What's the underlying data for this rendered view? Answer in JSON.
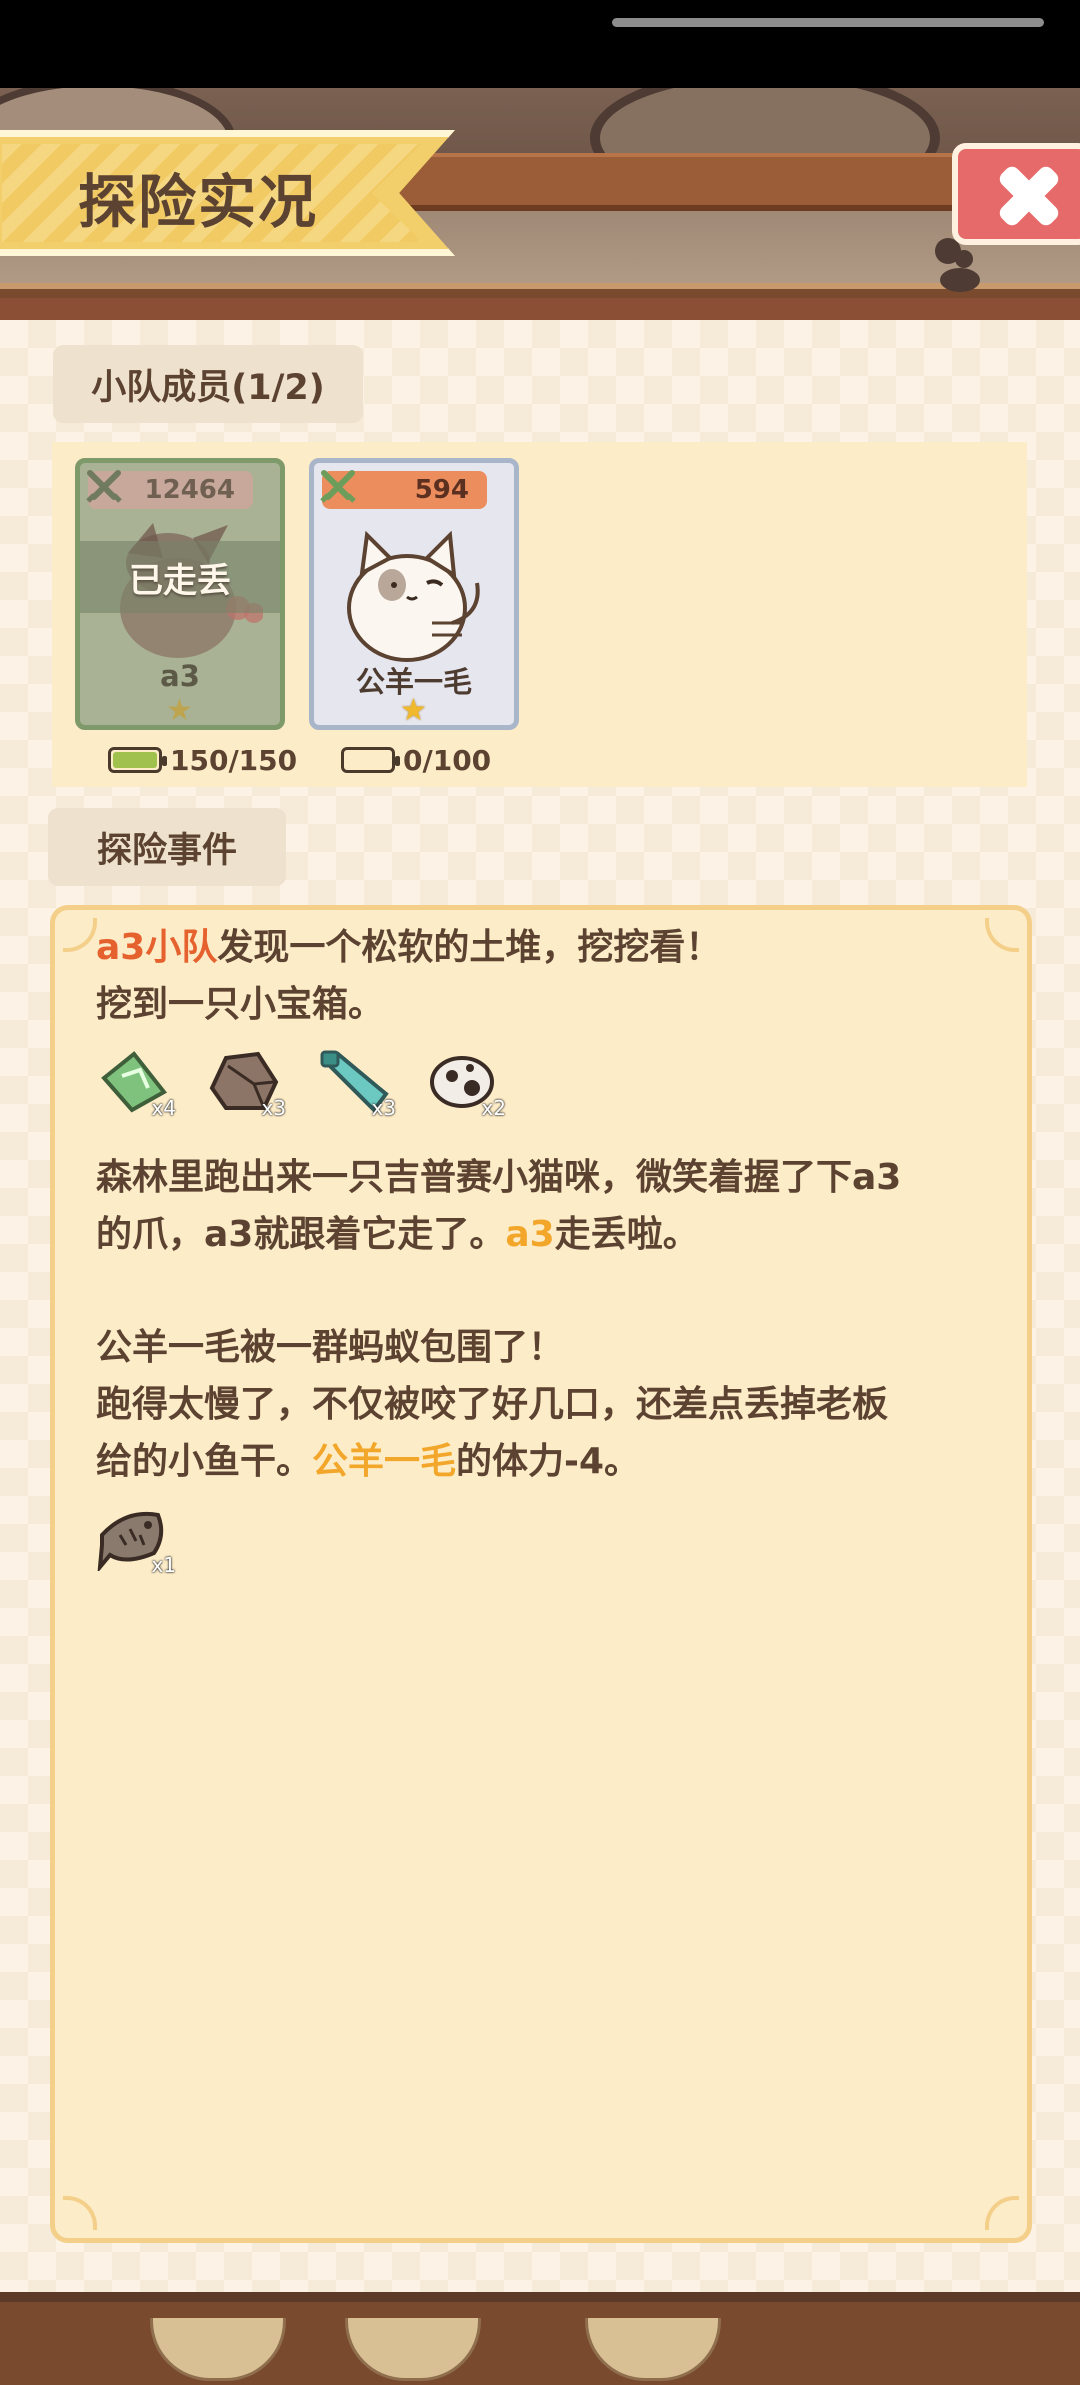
{
  "header": {
    "title": "探险实况",
    "close_icon": "close-x-icon"
  },
  "team": {
    "label": "小队成员(1/2)",
    "members": [
      {
        "name": "a3",
        "power": "12464",
        "status": "已走丢",
        "stamina": "150/150",
        "stamina_fraction": 1.0,
        "stars": 1
      },
      {
        "name": "公羊一毛",
        "power": "594",
        "status": "",
        "stamina": "0/100",
        "stamina_fraction": 0.0,
        "stars": 1
      }
    ]
  },
  "events": {
    "label": "探险事件",
    "paragraphs": [
      {
        "lines": [
          {
            "parts": [
              {
                "text": "a3小队",
                "style": "red"
              },
              {
                "text": "发现一个松软的土堆，挖挖看！",
                "style": "normal"
              }
            ]
          },
          {
            "parts": [
              {
                "text": "挖到一只小宝箱。",
                "style": "normal"
              }
            ]
          }
        ],
        "items": [
          {
            "icon": "green-crystal-icon",
            "qty": "x4"
          },
          {
            "icon": "rock-icon",
            "qty": "x3"
          },
          {
            "icon": "bottle-icon",
            "qty": "x3"
          },
          {
            "icon": "spotted-egg-icon",
            "qty": "x2"
          }
        ]
      },
      {
        "lines": [
          {
            "parts": [
              {
                "text": "森林里跑出来一只吉普赛小猫咪，微笑着握了下a3",
                "style": "normal"
              }
            ]
          },
          {
            "parts": [
              {
                "text": "的爪，a3就跟着它走了。",
                "style": "normal"
              },
              {
                "text": "a3",
                "style": "orange"
              },
              {
                "text": "走丢啦。",
                "style": "normal"
              }
            ]
          }
        ]
      },
      {
        "lines": [
          {
            "parts": [
              {
                "text": "公羊一毛被一群蚂蚁包围了！",
                "style": "normal"
              }
            ]
          },
          {
            "parts": [
              {
                "text": "跑得太慢了，不仅被咬了好几口，还差点丢掉老板",
                "style": "normal"
              }
            ]
          },
          {
            "parts": [
              {
                "text": "给的小鱼干。",
                "style": "normal"
              },
              {
                "text": "公羊一毛",
                "style": "orange"
              },
              {
                "text": "的体力-4。",
                "style": "normal"
              }
            ]
          }
        ],
        "items": [
          {
            "icon": "dried-fish-icon",
            "qty": "x1"
          }
        ]
      }
    ]
  },
  "colors": {
    "accent_red": "#e5612e",
    "accent_orange": "#f2a62a",
    "text_brown": "#5b4231"
  }
}
